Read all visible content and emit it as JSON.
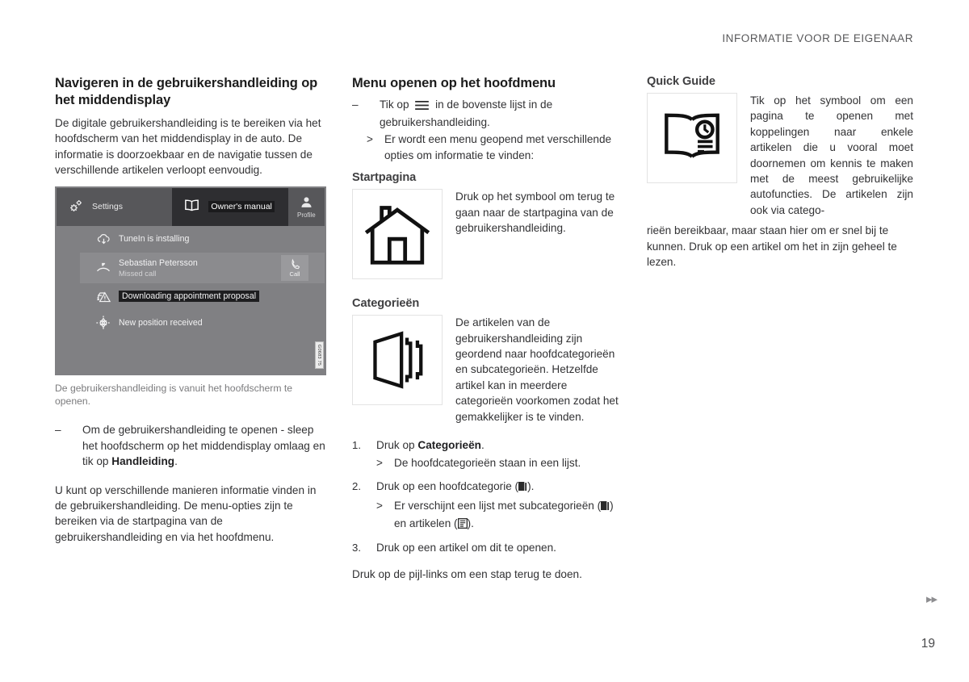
{
  "header": {
    "running_title": "INFORMATIE VOOR DE EIGENAAR"
  },
  "footer": {
    "page_number": "19",
    "arrows": "▸▸"
  },
  "col1": {
    "title": "Navigeren in de gebruikershandleiding op het middendisplay",
    "intro": "De digitale gebruikershandleiding is te bereiken via het hoofdscherm van het middendisplay in de auto. De informatie is doorzoekbaar en de navigatie tussen de verschillende artikelen verloopt eenvoudig.",
    "caption": "De gebruikershandleiding is vanuit het hoofdscherm te openen.",
    "dash_mark": "–",
    "dash_text_a": "Om de gebruikershandleiding te openen - sleep het hoofdscherm op het middendisplay omlaag en tik op ",
    "dash_bold": "Handleiding",
    "dash_text_b": ".",
    "closing": "U kunt op verschillende manieren informatie vinden in de gebruikershandleiding. De menu-opties zijn te bereiken via de startpagina van de gebruikershandleiding en via het hoofdmenu.",
    "hmi": {
      "settings_label": "Settings",
      "settings_icon": "gears-icon",
      "manual_label": "Owner's manual",
      "manual_icon": "open-book-icon",
      "profile_label": "Profile",
      "profile_icon": "person-icon",
      "rows": [
        {
          "icon": "cloud-download-icon",
          "text": "TuneIn is installing",
          "sub": "",
          "highlight": false,
          "action": ""
        },
        {
          "icon": "missed-call-icon",
          "text": "Sebastian Petersson",
          "sub": "Missed call",
          "highlight": false,
          "action": "Call"
        },
        {
          "icon": "car-warning-icon",
          "text": "Downloading appointment proposal",
          "sub": "",
          "highlight": true,
          "action": ""
        },
        {
          "icon": "position-compass-icon",
          "text": "New position received",
          "sub": "",
          "highlight": false,
          "action": ""
        }
      ],
      "image_id": "G0683 75"
    }
  },
  "col2": {
    "title": "Menu openen op het hoofdmenu",
    "dash_mark": "–",
    "dash_text_a": "Tik op ",
    "dash_icon": "hamburger-menu-icon",
    "dash_text_b": " in de bovenste lijst in de gebruikershandleiding.",
    "gt_mark": ">",
    "gt_text": "Er wordt een menu geopend met verschillende opties om informatie te vinden:",
    "startpage": {
      "heading": "Startpagina",
      "icon": "house-icon",
      "text": "Druk op het symbool om terug te gaan naar de startpagina van de gebruikershandleiding."
    },
    "categories": {
      "heading": "Categorieën",
      "icon": "page-stack-icon",
      "text": "De artikelen van de gebruikershandleiding zijn geordend naar hoofdcategorieën en subcategorieën. Hetzelfde artikel kan in meerdere categorieën voorkomen zodat het gemakkelijker is te vinden."
    },
    "steps": [
      {
        "num": "1.",
        "text_a": "Druk op ",
        "bold": "Categorieën",
        "text_b": "."
      },
      {
        "num": "2.",
        "text_a": "Druk op een hoofdcategorie (",
        "icon": "category-page-icon",
        "text_b": ")."
      },
      {
        "num": "3.",
        "text_a": "Druk op een artikel om dit te openen.",
        "bold": "",
        "text_b": ""
      }
    ],
    "step1_result_mark": ">",
    "step1_result": "De hoofdcategorieën staan in een lijst.",
    "step2_result_mark": ">",
    "step2_result_a": "Er verschijnt een lijst met subcategorieën (",
    "step2_result_icon_a": "category-page-icon",
    "step2_result_b": ") en artikelen (",
    "step2_result_icon_b": "article-icon",
    "step2_result_c": ").",
    "closing": "Druk op de pijl-links om een stap terug te doen."
  },
  "col3": {
    "heading": "Quick Guide",
    "icon": "open-book-clock-icon",
    "text_indented": "Tik op het symbool om een pagina te openen met koppelingen naar enkele artikelen die u vooral moet doornemen om kennis te maken met de meest gebruikelijke autofuncties. De artikelen zijn ook via catego-",
    "text_full": "rieën bereikbaar, maar staan hier om er snel bij te kunnen. Druk op een artikel om het in zijn geheel te lezen."
  },
  "colors": {
    "text": "#323234",
    "heading": "#1c1c1c",
    "muted": "#7b7b7d",
    "hmi_bg": "#808083",
    "hmi_topbar": "#57575a",
    "hmi_active_tab": "#2e2e31"
  }
}
